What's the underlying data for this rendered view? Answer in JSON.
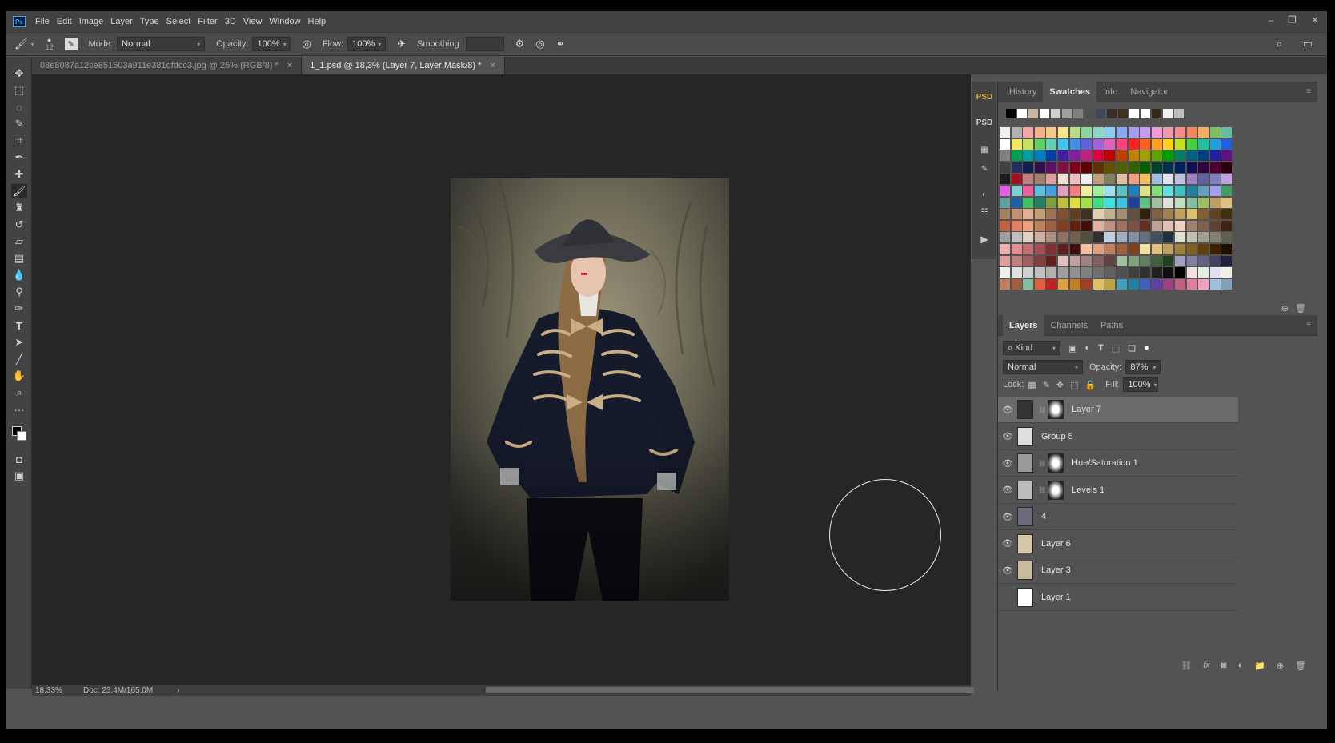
{
  "menubar": {
    "items": [
      "File",
      "Edit",
      "Image",
      "Layer",
      "Type",
      "Select",
      "Filter",
      "3D",
      "View",
      "Window",
      "Help"
    ]
  },
  "options": {
    "brush_size": "12",
    "mode_label": "Mode:",
    "mode_value": "Normal",
    "opacity_label": "Opacity:",
    "opacity_value": "100%",
    "flow_label": "Flow:",
    "flow_value": "100%",
    "smoothing_label": "Smoothing:",
    "smoothing_value": ""
  },
  "tabs": [
    {
      "label": "08e8087a12ce851503a911e381dfdcc3.jpg @ 25% (RGB/8) *",
      "active": false
    },
    {
      "label": "1_1.psd @ 18,3% (Layer 7, Layer Mask/8) *",
      "active": true
    }
  ],
  "status": {
    "zoom": "18,33%",
    "doc": "Doc: 23,4M/165,0M"
  },
  "swatches_panel": {
    "tabs": [
      "History",
      "Swatches",
      "Info",
      "Navigator"
    ],
    "active_tab": "Swatches",
    "recent": [
      "#000000",
      "#ffffff",
      "#c8b8a0",
      "#ffffff",
      "#d0d0d0",
      "#a0a0a0",
      "#808080",
      "#505050",
      "#404858",
      "#383028",
      "#403020",
      "#ffffff",
      "#ffffff",
      "#382818",
      "#f0f0f0",
      "#c0c0c0"
    ],
    "grid": [
      "#f0f0f0",
      "#b0b0b0",
      "#f4a6a6",
      "#f5b08a",
      "#f7c88a",
      "#f5e68a",
      "#b8dc8a",
      "#8ad6a0",
      "#8ad6c8",
      "#8acdf0",
      "#8aa8f0",
      "#a89af0",
      "#c89af0",
      "#f09ad8",
      "#f09ab0",
      "#f48a8a",
      "#f08860",
      "#f4b060",
      "#7ac060",
      "#60c0a0",
      "#ffffff",
      "#f4e860",
      "#c8e060",
      "#60d060",
      "#60d0b0",
      "#40c8f0",
      "#4090e8",
      "#6060e0",
      "#a060e0",
      "#e060c0",
      "#ff4080",
      "#ff2020",
      "#ff6020",
      "#ffa020",
      "#ffd020",
      "#c0e020",
      "#40d040",
      "#20c0a0",
      "#20a0e0",
      "#2060e0",
      "#808080",
      "#00a050",
      "#00a0a0",
      "#0080c0",
      "#0040a0",
      "#4020a0",
      "#8020a0",
      "#c02080",
      "#e00040",
      "#c00000",
      "#c04000",
      "#c08000",
      "#a0a000",
      "#60a000",
      "#00a000",
      "#008060",
      "#006080",
      "#004080",
      "#2020a0",
      "#601080",
      "#404040",
      "#203060",
      "#102050",
      "#301050",
      "#601060",
      "#801040",
      "#800020",
      "#600000",
      "#603000",
      "#605000",
      "#506000",
      "#306000",
      "#006000",
      "#004030",
      "#003050",
      "#002060",
      "#101050",
      "#300040",
      "#500030",
      "#300010",
      "#202020",
      "#a01020",
      "#c08080",
      "#a08070",
      "#e0a0a0",
      "#f0e0d0",
      "#f0c0c0",
      "#f0f0f0",
      "#c0a080",
      "#808060",
      "#e0c0a0",
      "#f0a080",
      "#f0c060",
      "#a0c0e0",
      "#e0e0f0",
      "#c0c0e0",
      "#a080c0",
      "#6060a0",
      "#8080c0",
      "#c0a0e0",
      "#e060e0",
      "#80d0d0",
      "#f060a0",
      "#60c0e0",
      "#40a0e0",
      "#e0a0c0",
      "#f08080",
      "#f0f0a0",
      "#a0f0a0",
      "#a0e0f0",
      "#60c0c0",
      "#2080c0",
      "#e0e080",
      "#80e080",
      "#60e0e0",
      "#40c0c0",
      "#2080a0",
      "#60a0c0",
      "#a0a0f0",
      "#40a060",
      "#60a0a0",
      "#2060a0",
      "#40c060",
      "#208060",
      "#80a040",
      "#c0c040",
      "#e0e040",
      "#a0e040",
      "#40e080",
      "#40e0e0",
      "#40c0e0",
      "#2040a0",
      "#60c080",
      "#a0c0a0",
      "#e0e0e0",
      "#c0e0c0",
      "#80c0a0",
      "#a0c060",
      "#c0a060",
      "#e0c080",
      "#a08060",
      "#c09070",
      "#e0b090",
      "#c0a070",
      "#a07050",
      "#805030",
      "#604020",
      "#403020",
      "#e0d0b0",
      "#c0b090",
      "#a09070",
      "#605040",
      "#302010",
      "#806040",
      "#a08050",
      "#c0a060",
      "#e0c070",
      "#806030",
      "#604020",
      "#403010",
      "#c06040",
      "#e08060",
      "#f0a080",
      "#c08060",
      "#a06040",
      "#804020",
      "#602010",
      "#401000",
      "#e0b0a0",
      "#c09080",
      "#a07060",
      "#805040",
      "#603020",
      "#c0a090",
      "#e0c0b0",
      "#f0d0c0",
      "#a08070",
      "#806050",
      "#604030",
      "#402010",
      "#a0a0a0",
      "#c0c0c0",
      "#e0d0c0",
      "#d0b0a0",
      "#b09080",
      "#907060",
      "#706050",
      "#505040",
      "#303030",
      "#c0d0e0",
      "#a0b0c0",
      "#8090a0",
      "#607080",
      "#405060",
      "#203040",
      "#e0e0d0",
      "#c0c0b0",
      "#a0a090",
      "#808070",
      "#606050",
      "#f0b0b0",
      "#e09090",
      "#c07070",
      "#a05050",
      "#803030",
      "#602020",
      "#401010",
      "#f0c0a0",
      "#e0a080",
      "#c08060",
      "#a06040",
      "#804020",
      "#f0e0a0",
      "#e0c080",
      "#c0a060",
      "#a08040",
      "#806020",
      "#604010",
      "#402000",
      "#201000",
      "#e0a0a0",
      "#c08080",
      "#a06060",
      "#804040",
      "#602020",
      "#e0c0c0",
      "#c0a0a0",
      "#a08080",
      "#806060",
      "#604040",
      "#a0c0a0",
      "#80a080",
      "#608060",
      "#406040",
      "#204020",
      "#a0a0c0",
      "#8080a0",
      "#606080",
      "#404060",
      "#202040",
      "#f0f0f0",
      "#e0e0e0",
      "#d0d0d0",
      "#c0c0c0",
      "#b0b0b0",
      "#a0a0a0",
      "#909090",
      "#808080",
      "#707070",
      "#606060",
      "#505050",
      "#404040",
      "#303030",
      "#202020",
      "#101010",
      "#000000",
      "#f0e0e0",
      "#e0f0e0",
      "#e0e0f0",
      "#f0f0e0",
      "#c08060",
      "#a06040",
      "#80c0a0",
      "#e06040",
      "#c02020",
      "#e0a040",
      "#c08020",
      "#a04020",
      "#e0c060",
      "#c0a040",
      "#40a0c0",
      "#2080a0",
      "#4060c0",
      "#6040a0",
      "#a04080",
      "#c06080",
      "#e080a0",
      "#f0a0c0",
      "#a0c0e0",
      "#80a0c0"
    ]
  },
  "layers_panel": {
    "tabs": [
      "Layers",
      "Channels",
      "Paths"
    ],
    "active_tab": "Layers",
    "filter_label": "Kind",
    "blend_mode": "Normal",
    "opacity_label": "Opacity:",
    "opacity_value": "87%",
    "lock_label": "Lock:",
    "fill_label": "Fill:",
    "fill_value": "100%",
    "layers": [
      {
        "name": "Layer 7",
        "selected": true,
        "visible": true,
        "thumb": "#333",
        "mask": true
      },
      {
        "name": "Group 5",
        "selected": false,
        "visible": true,
        "thumb": "#ddd",
        "mask": false
      },
      {
        "name": "Hue/Saturation 1",
        "selected": false,
        "visible": true,
        "thumb": "#999",
        "mask": true
      },
      {
        "name": "Levels 1",
        "selected": false,
        "visible": true,
        "thumb": "#bbb",
        "mask": true
      },
      {
        "name": "4",
        "selected": false,
        "visible": true,
        "thumb": "#6a6a7a",
        "mask": false
      },
      {
        "name": "Layer 6",
        "selected": false,
        "visible": true,
        "thumb": "#d8c8a8",
        "mask": false
      },
      {
        "name": "Layer 3",
        "selected": false,
        "visible": true,
        "thumb": "#c8bca0",
        "mask": false
      },
      {
        "name": "Layer 1",
        "selected": false,
        "visible": false,
        "thumb": "#ffffff",
        "mask": false
      }
    ]
  }
}
